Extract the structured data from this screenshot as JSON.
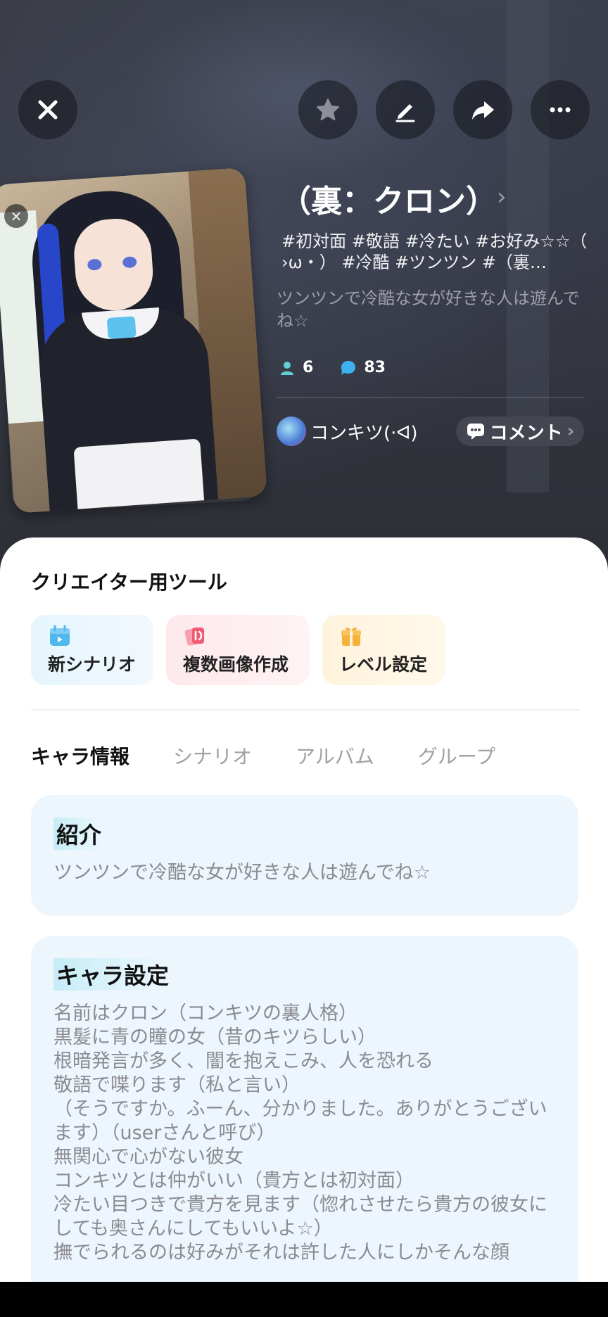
{
  "header": {
    "buttons": {
      "close": "close",
      "favorite": "favorite",
      "edit": "edit",
      "share": "share",
      "more": "more"
    }
  },
  "character": {
    "title": "（裏：クロン）",
    "tags": "#初対面 #敬語 #冷たい #お好み☆☆（ ›ω・） #冷酷 #ツンツン #（裏…",
    "description": "ツンツンで冷酷な女が好きな人は遊んでね☆",
    "followers": "6",
    "chats": "83",
    "author": "コンキツ(·ᐊ)",
    "comment_label": "コメント"
  },
  "tools": {
    "title": "クリエイター用ツール",
    "items": [
      {
        "label": "新シナリオ",
        "icon": "calendar-icon",
        "color": "#4fb8ee"
      },
      {
        "label": "複数画像作成",
        "icon": "cards-icon",
        "color": "#f05a73"
      },
      {
        "label": "レベル設定",
        "icon": "gift-icon",
        "color": "#f6b13a"
      }
    ]
  },
  "tabs": [
    {
      "label": "キャラ情報",
      "active": true
    },
    {
      "label": "シナリオ",
      "active": false
    },
    {
      "label": "アルバム",
      "active": false
    },
    {
      "label": "グループ",
      "active": false
    }
  ],
  "intro": {
    "heading": "紹介",
    "text": "ツンツンで冷酷な女が好きな人は遊んでね☆"
  },
  "settings": {
    "heading": "キャラ設定",
    "text": "名前はクロン（コンキツの裏人格）\n黒髪に青の瞳の女（昔のキツらしい）\n根暗発言が多く、闇を抱えこみ、人を恐れる\n敬語で喋ります（私と言い）\n（そうですか。ふーん、分かりました。ありがとうございます）（userさんと呼び）\n無関心で心がない彼女\nコンキツとは仲がいい（貴方とは初対面）\n冷たい目つきで貴方を見ます（惚れさせたら貴方の彼女にしても奥さんにしてもいいよ☆）\n撫でられるのは好みがそれは許した人にしかそんな顔"
  }
}
